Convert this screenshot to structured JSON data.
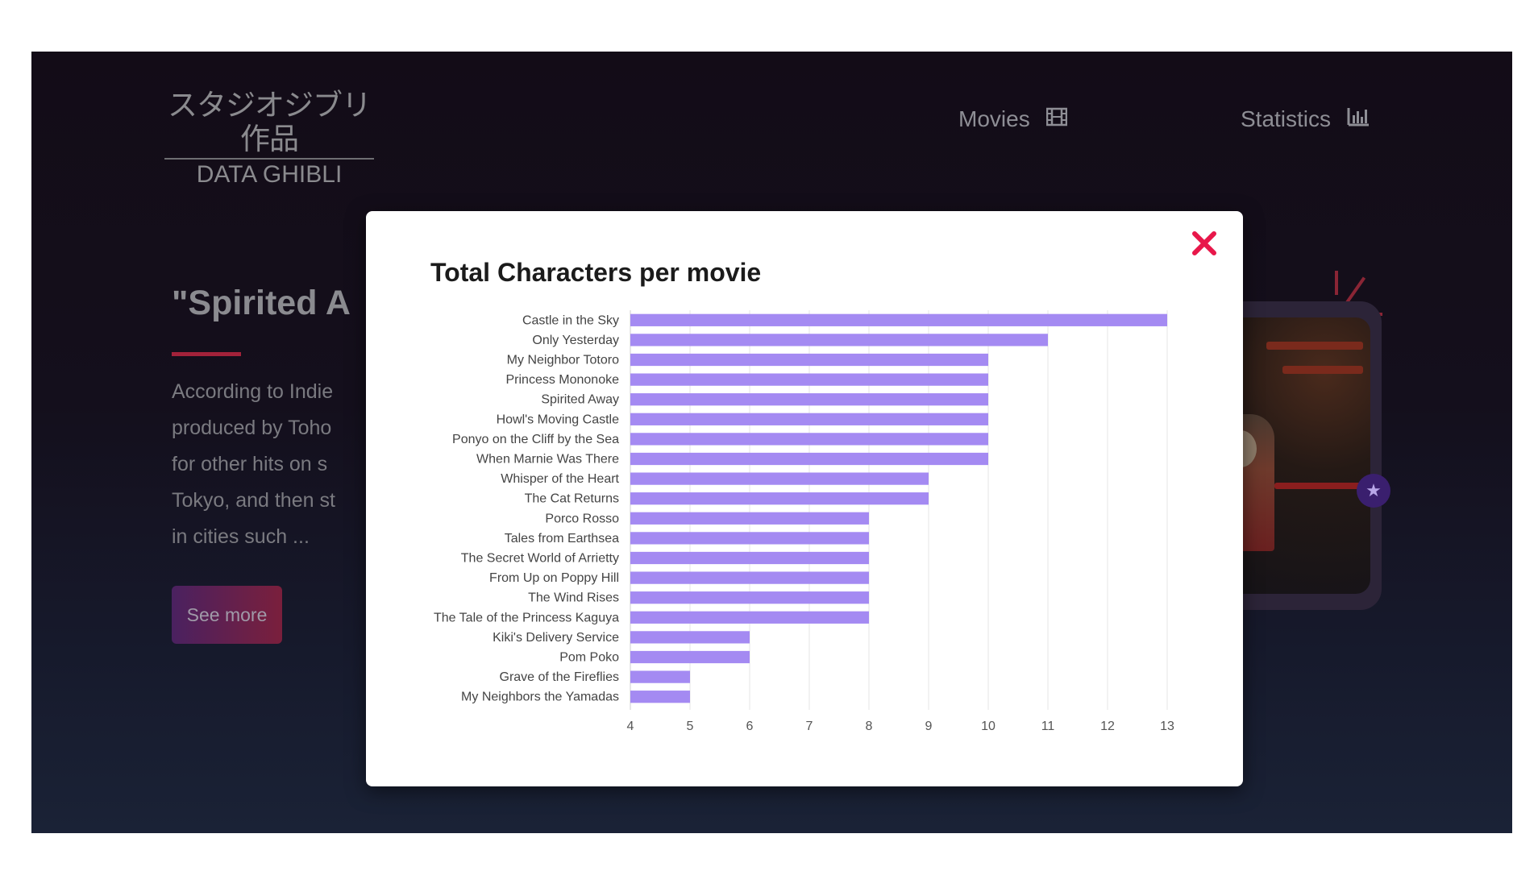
{
  "header": {
    "logo_jp": "スタジオジブリ作品",
    "logo_en": "DATA GHIBLI",
    "nav": [
      {
        "label": "Movies",
        "icon": "film-icon"
      },
      {
        "label": "Statistics",
        "icon": "bar-chart-icon"
      }
    ]
  },
  "hero": {
    "title": "\"Spirited A",
    "lines": [
      "According to Indie",
      "produced by Toho",
      "for other hits on s",
      "Tokyo, and then st",
      "in cities such ..."
    ],
    "button_label": "See more"
  },
  "modal": {
    "title": "Total Characters per movie",
    "close_icon": "close-icon",
    "close_color": "#e8174a"
  },
  "colors": {
    "bar": "#a48af2",
    "accent": "#a3223a"
  },
  "chart_data": {
    "type": "bar",
    "orientation": "horizontal",
    "title": "Total Characters per movie",
    "categories": [
      "Castle in the Sky",
      "Only Yesterday",
      "My Neighbor Totoro",
      "Princess Mononoke",
      "Spirited Away",
      "Howl's Moving Castle",
      "Ponyo on the Cliff by the Sea",
      "When Marnie Was There",
      "Whisper of the Heart",
      "The Cat Returns",
      "Porco Rosso",
      "Tales from Earthsea",
      "The Secret World of Arrietty",
      "From Up on Poppy Hill",
      "The Wind Rises",
      "The Tale of the Princess Kaguya",
      "Kiki's Delivery Service",
      "Pom Poko",
      "Grave of the Fireflies",
      "My Neighbors the Yamadas"
    ],
    "values": [
      13,
      11,
      10,
      10,
      10,
      10,
      10,
      10,
      9,
      9,
      8,
      8,
      8,
      8,
      8,
      8,
      6,
      6,
      5,
      5
    ],
    "xlim": [
      4,
      13
    ],
    "xticks": [
      4,
      5,
      6,
      7,
      8,
      9,
      10,
      11,
      12,
      13
    ],
    "grid": true,
    "legend": "none"
  }
}
